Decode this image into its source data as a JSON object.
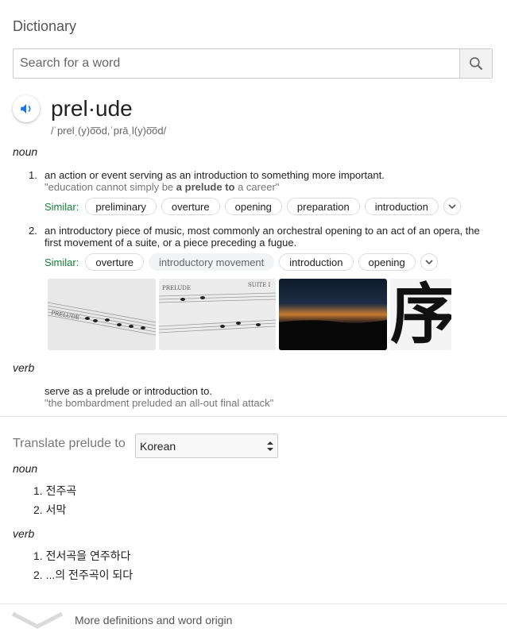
{
  "header": {
    "title": "Dictionary"
  },
  "search": {
    "placeholder": "Search for a word",
    "value": ""
  },
  "entry": {
    "word": "prel·ude",
    "pronunciation": "/ˈprelˌ(y)o͞od,ˈprāˌl(y)o͞od/"
  },
  "noun": {
    "pos": "noun",
    "definitions": [
      {
        "num": "1.",
        "text": "an action or event serving as an introduction to something more important.",
        "example_pre": "\"education cannot simply be ",
        "example_bold": "a prelude to",
        "example_post": " a career\"",
        "similar_label": "Similar:",
        "similar": [
          "preliminary",
          "overture",
          "opening",
          "preparation",
          "introduction"
        ]
      },
      {
        "num": "2.",
        "text": "an introductory piece of music, most commonly an orchestral opening to an act of an opera, the first movement of a suite, or a piece preceding a fugue.",
        "similar_label": "Similar:",
        "similar": [
          "overture",
          "introductory movement",
          "introduction",
          "opening"
        ]
      }
    ]
  },
  "images": {
    "sheet_label_1": "PRELUDE",
    "sheet_label_2": "PRELUDE",
    "sheet_label_3": "SUITE I",
    "kanji": "序"
  },
  "verb": {
    "pos": "verb",
    "text": "serve as a prelude or introduction to.",
    "example": "\"the bombardment preluded an all-out final attack\""
  },
  "translate": {
    "label": "Translate prelude to",
    "language": "Korean",
    "noun_pos": "noun",
    "noun_items": [
      "1. 전주곡",
      "2. 서막"
    ],
    "verb_pos": "verb",
    "verb_items": [
      "1. 전서곡을 연주하다",
      "2. ...의 전주곡이 되다"
    ]
  },
  "footer": {
    "more": "More definitions and word origin"
  },
  "colors": {
    "accent_green": "#188038",
    "speaker_blue": "#1a73e8"
  }
}
